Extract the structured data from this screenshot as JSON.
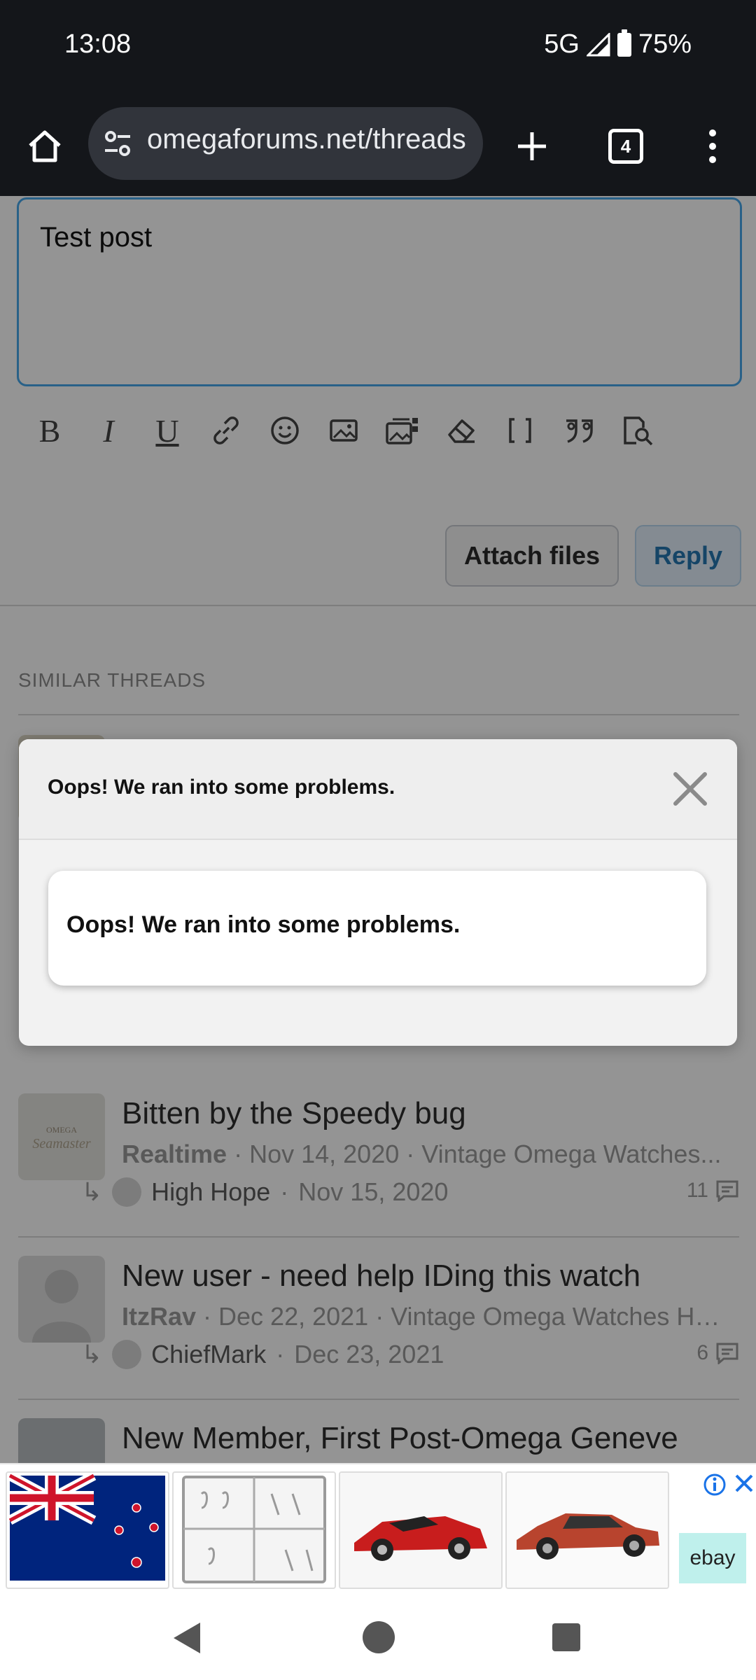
{
  "status_bar": {
    "time": "13:08",
    "network": "5G",
    "battery": "75%"
  },
  "browser": {
    "url": "omegaforums.net/threads",
    "tab_count": "4"
  },
  "editor": {
    "text": "Test post",
    "attach_label": "Attach files",
    "reply_label": "Reply",
    "toolbar_icons": [
      "bold-icon",
      "italic-icon",
      "underline-icon",
      "link-icon",
      "smiley-icon",
      "image-icon",
      "media-gallery-icon",
      "eraser-icon",
      "brackets-icon",
      "quote-icon",
      "preview-icon"
    ]
  },
  "similar": {
    "heading": "SIMILAR THREADS",
    "threads": [
      {
        "title": "Bitten by the Speedy bug",
        "author": "Realtime",
        "date": "Nov 14, 2020",
        "forum": "Vintage Omega Watches...",
        "last_user": "High Hope",
        "last_date": "Nov 15, 2020",
        "replies": "11"
      },
      {
        "title": "New user - need help IDing this watch",
        "author": "ItzRav",
        "date": "Dec 22, 2021",
        "forum": "Vintage Omega Watches Hel...",
        "last_user": "ChiefMark",
        "last_date": "Dec 23, 2021",
        "replies": "6"
      },
      {
        "title": "New Member, First Post-Omega Geneve"
      }
    ]
  },
  "modal": {
    "title": "Oops! We ran into some problems.",
    "message": "Oops! We ran into some problems."
  },
  "ad": {
    "brand": "ebay"
  },
  "colors": {
    "accent": "#2577b1",
    "focus_border": "#47a7eb",
    "chrome_bg": "#14161a"
  }
}
